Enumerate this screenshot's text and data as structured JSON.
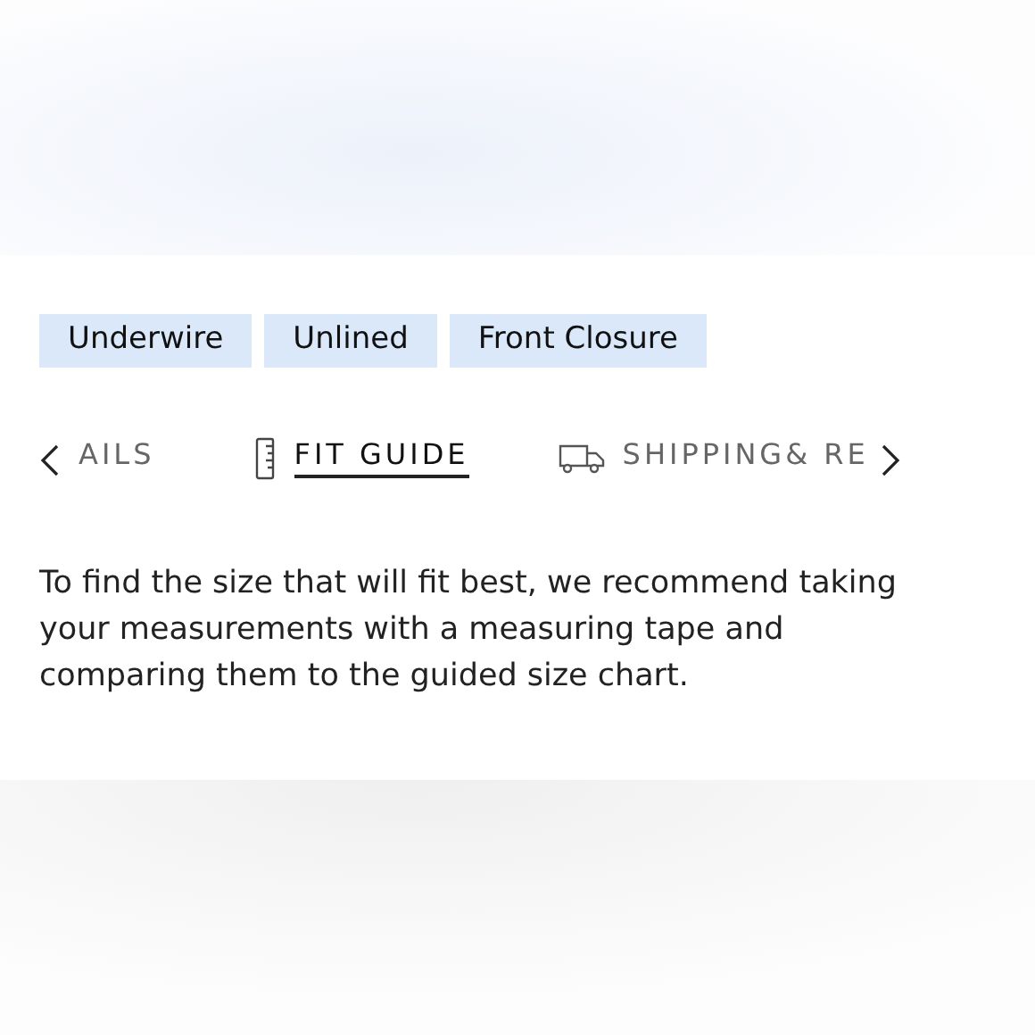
{
  "tags": [
    "Underwire",
    "Unlined",
    "Front Closure"
  ],
  "tabs": [
    {
      "label": "AILS",
      "kind": "plain",
      "selected": false
    },
    {
      "label": "FIT GUIDE",
      "kind": "ruler",
      "selected": true
    },
    {
      "label": "SHIPPING& RE",
      "kind": "truck",
      "selected": false
    }
  ],
  "description": "To find the size that will fit best, we recommend taking your measurements with a measuring tape and comparing them to the guided size chart."
}
